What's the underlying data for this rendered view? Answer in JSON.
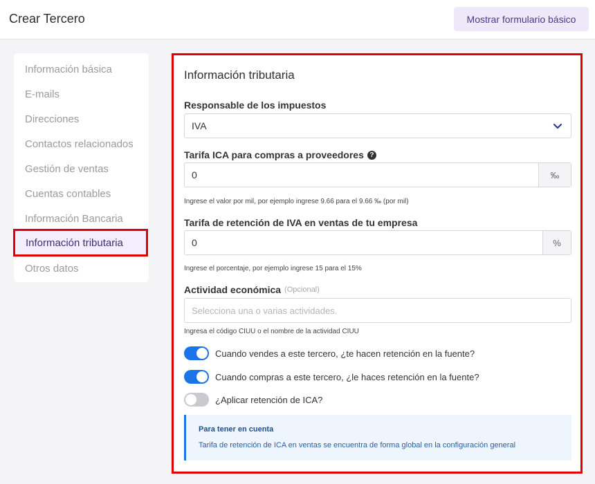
{
  "header": {
    "title": "Crear Tercero",
    "basic_form_button": "Mostrar formulario básico"
  },
  "sidebar": {
    "items": [
      {
        "label": "Información básica"
      },
      {
        "label": "E-mails"
      },
      {
        "label": "Direcciones"
      },
      {
        "label": "Contactos relacionados"
      },
      {
        "label": "Gestión de ventas"
      },
      {
        "label": "Cuentas contables"
      },
      {
        "label": "Información Bancaria"
      },
      {
        "label": "Información tributaria",
        "active": true
      },
      {
        "label": "Otros datos"
      }
    ]
  },
  "panel": {
    "title": "Información tributaria",
    "tax_responsible": {
      "label": "Responsable de los impuestos",
      "value": "IVA",
      "icon": "chevron-down-icon"
    },
    "ica_rate": {
      "label": "Tarifa ICA para compras a proveedores",
      "help_icon": "?",
      "value": "0",
      "unit": "‰",
      "help": "Ingrese el valor por mil, por ejemplo ingrese 9.66 para el 9.66 ‰ (por mil)"
    },
    "iva_retention": {
      "label": "Tarifa de retención de IVA en ventas de tu empresa",
      "value": "0",
      "unit": "%",
      "help": "Ingrese el porcentaje, por ejemplo ingrese 15 para el 15%"
    },
    "economic_activity": {
      "label": "Actividad económica",
      "optional": "(Opcional)",
      "placeholder": "Selecciona una o varias actividades.",
      "help": "Ingresa el código CIUU o el nombre de la actividad CIUU"
    },
    "toggles": [
      {
        "label": "Cuando vendes a este tercero, ¿te hacen retención en la fuente?",
        "on": true
      },
      {
        "label": "Cuando compras a este tercero, ¿le haces retención en la fuente?",
        "on": true
      },
      {
        "label": "¿Aplicar retención de ICA?",
        "on": false
      }
    ],
    "note": {
      "title": "Para tener en cuenta",
      "text": "Tarifa de retención de ICA en ventas se encuentra de forma global en la configuración general"
    }
  },
  "colors": {
    "accent": "#1a73e8",
    "highlight_border": "#e00000",
    "active_nav_text": "#3b2e7e"
  }
}
